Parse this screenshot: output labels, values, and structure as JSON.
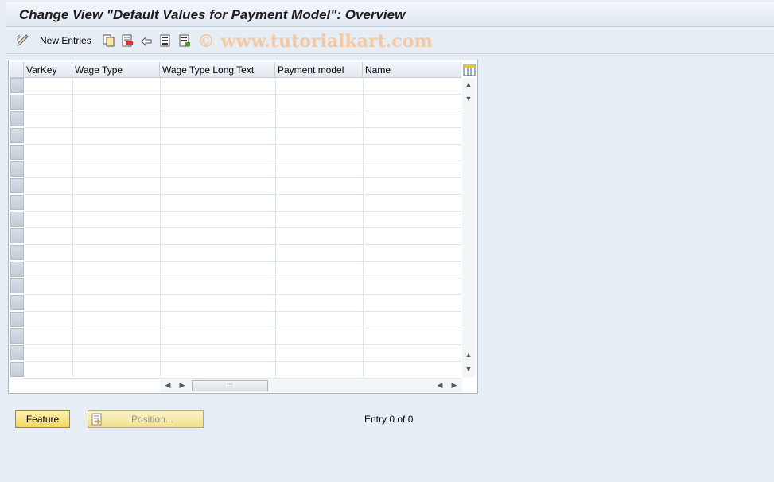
{
  "title": "Change View \"Default Values for Payment Model\": Overview",
  "toolbar": {
    "new_entries_label": "New Entries",
    "watermark": "© www.tutorialkart.com",
    "icons": [
      "display-change-icon",
      "copy-icon",
      "delete-icon",
      "undo-icon",
      "select-all-icon",
      "select-block-icon"
    ]
  },
  "table": {
    "columns": [
      "VarKey",
      "Wage Type",
      "Wage Type Long Text",
      "Payment model",
      "Name"
    ],
    "visible_rows": 18
  },
  "buttons": {
    "feature": "Feature",
    "position": "Position..."
  },
  "status": {
    "entry_count": "Entry 0 of 0"
  },
  "colors": {
    "button_yellow": "#f2d766",
    "background": "#e8eef5"
  }
}
